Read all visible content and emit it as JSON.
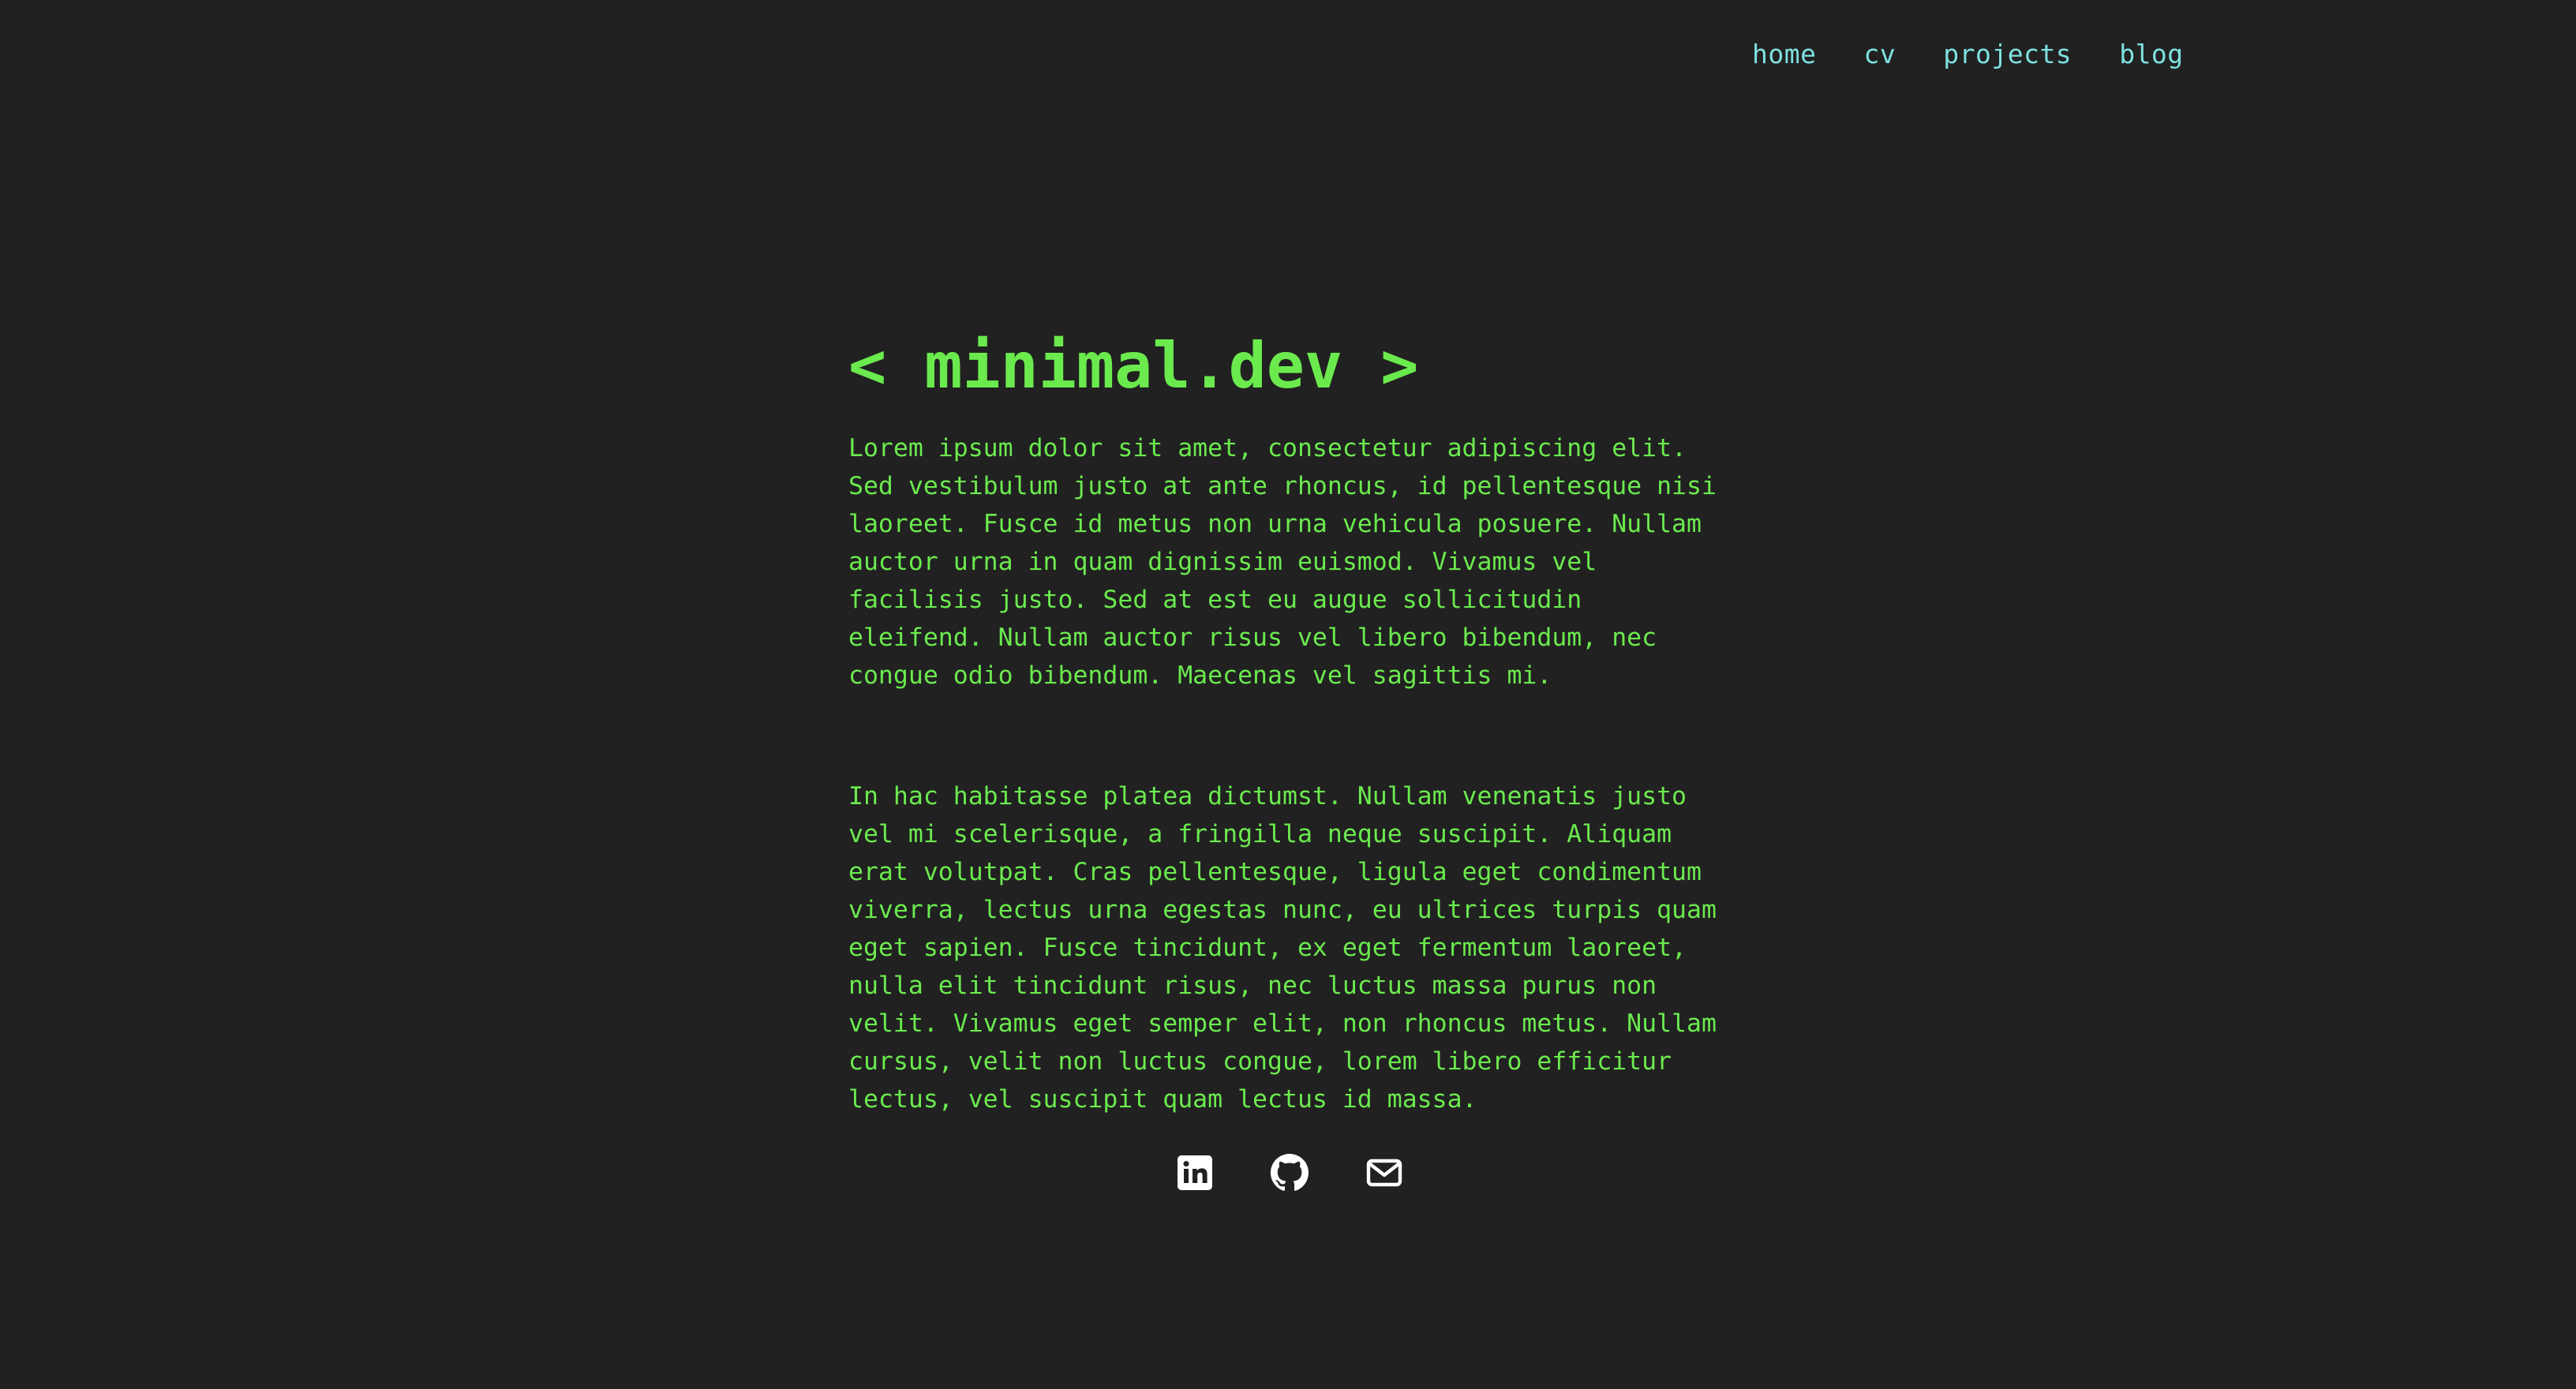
{
  "nav": {
    "items": [
      {
        "label": "home"
      },
      {
        "label": "cv"
      },
      {
        "label": "projects"
      },
      {
        "label": "blog"
      }
    ]
  },
  "main": {
    "title": "< minimal.dev >",
    "paragraphs": [
      "Lorem ipsum dolor sit amet, consectetur adipiscing elit.\nSed vestibulum justo at ante rhoncus, id pellentesque nisi\nlaoreet. Fusce id metus non urna vehicula posuere. Nullam\nauctor urna in quam dignissim euismod. Vivamus vel\nfacilisis justo. Sed at est eu augue sollicitudin\neleifend. Nullam auctor risus vel libero bibendum, nec\ncongue odio bibendum. Maecenas vel sagittis mi.",
      "In hac habitasse platea dictumst. Nullam venenatis justo\nvel mi scelerisque, a fringilla neque suscipit. Aliquam\nerat volutpat. Cras pellentesque, ligula eget condimentum\nviverra, lectus urna egestas nunc, eu ultrices turpis quam\neget sapien. Fusce tincidunt, ex eget fermentum laoreet,\nnulla elit tincidunt risus, nec luctus massa purus non\nvelit. Vivamus eget semper elit, non rhoncus metus. Nullam\ncursus, velit non luctus congue, lorem libero efficitur\nlectus, vel suscipit quam lectus id massa."
    ]
  },
  "social": {
    "icons": [
      "linkedin-icon",
      "github-icon",
      "email-icon"
    ]
  },
  "colors": {
    "background": "#212121",
    "nav_link": "#7fe0e0",
    "text": "#6bea4e",
    "icon": "#ffffff"
  }
}
